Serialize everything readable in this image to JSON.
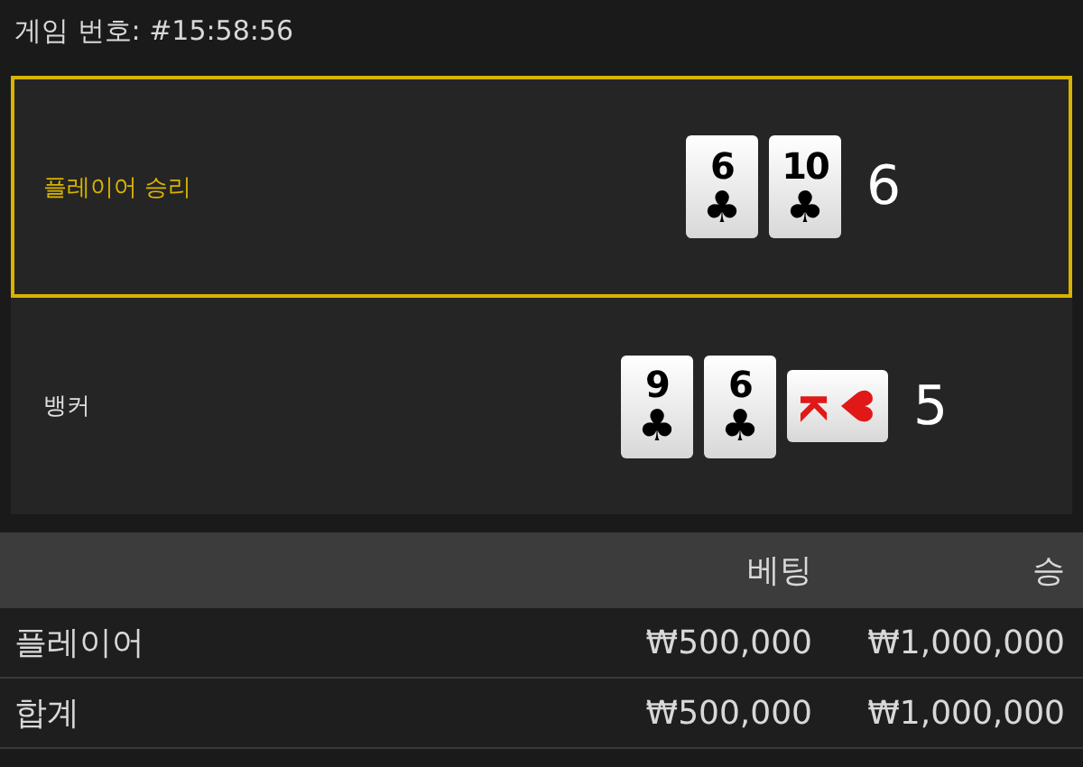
{
  "game_number": "게임 번호: #15:58:56",
  "hands": [
    {
      "label": "플레이어 승리",
      "winner": true,
      "score": "6",
      "cards": [
        {
          "rank": "6",
          "suit": "♣",
          "color": "#000000",
          "kind": "upright"
        },
        {
          "rank": "10",
          "suit": "♣",
          "color": "#000000",
          "kind": "upright"
        }
      ]
    },
    {
      "label": "뱅커",
      "winner": false,
      "score": "5",
      "cards": [
        {
          "rank": "9",
          "suit": "♣",
          "color": "#000000",
          "kind": "upright"
        },
        {
          "rank": "6",
          "suit": "♣",
          "color": "#000000",
          "kind": "upright"
        },
        {
          "rank": "K",
          "suit": "♥",
          "color": "#e01818",
          "kind": "sideways"
        }
      ]
    }
  ],
  "table": {
    "columns": [
      "베팅",
      "승"
    ],
    "rows": [
      {
        "label": "플레이어",
        "cells": [
          "₩500,000",
          "₩1,000,000"
        ]
      },
      {
        "label": "합계",
        "cells": [
          "₩500,000",
          "₩1,000,000"
        ]
      }
    ]
  }
}
